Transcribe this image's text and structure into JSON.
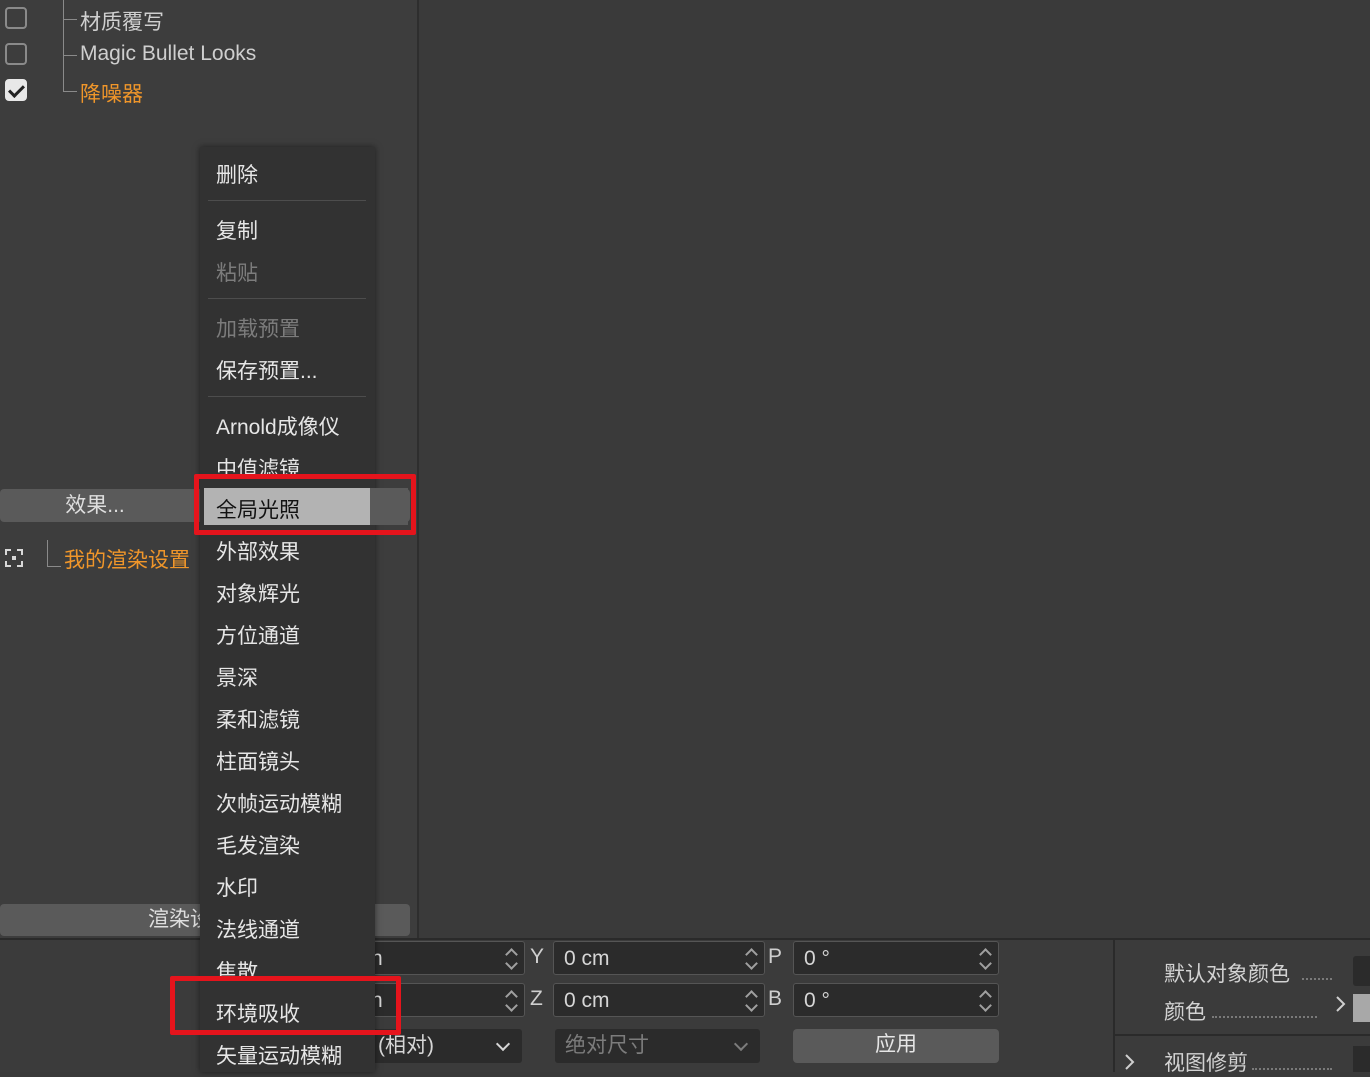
{
  "tree": {
    "items": [
      {
        "label": "材质覆写",
        "checked": false
      },
      {
        "label": "Magic Bullet Looks",
        "checked": false
      },
      {
        "label": "降噪器",
        "checked": true
      }
    ],
    "render_setting": "我的渲染设置"
  },
  "buttons": {
    "effects": "效果...",
    "render_settings_partial": "渲染设"
  },
  "context_menu": {
    "items": [
      {
        "label": "删除",
        "enabled": true
      },
      {
        "label": "复制",
        "enabled": true
      },
      {
        "label": "粘贴",
        "enabled": false
      },
      {
        "label": "加载预置",
        "enabled": false
      },
      {
        "label": "保存预置...",
        "enabled": true
      },
      {
        "label": "Arnold成像仪",
        "enabled": true
      },
      {
        "label": "中值滤镜",
        "enabled": true
      },
      {
        "label": "全局光照",
        "enabled": true,
        "highlighted": true
      },
      {
        "label": "外部效果",
        "enabled": true
      },
      {
        "label": "对象辉光",
        "enabled": true
      },
      {
        "label": "方位通道",
        "enabled": true
      },
      {
        "label": "景深",
        "enabled": true
      },
      {
        "label": "柔和滤镜",
        "enabled": true
      },
      {
        "label": "柱面镜头",
        "enabled": true
      },
      {
        "label": "次帧运动模糊",
        "enabled": true
      },
      {
        "label": "毛发渲染",
        "enabled": true
      },
      {
        "label": "水印",
        "enabled": true
      },
      {
        "label": "法线通道",
        "enabled": true
      },
      {
        "label": "焦散",
        "enabled": true
      },
      {
        "label": "环境吸收",
        "enabled": true
      },
      {
        "label": "矢量运动模糊",
        "enabled": true
      }
    ]
  },
  "coords": {
    "y_label": "Y",
    "y_value": "0 cm",
    "z_label": "Z",
    "z_value": "0 cm",
    "p_label": "P",
    "p_value": "0 °",
    "b_label": "B",
    "b_value": "0 °",
    "x_partial": "n",
    "z_partial": "n",
    "mode_select": "(相对)",
    "size_select": "绝对尺寸",
    "apply": "应用"
  },
  "attributes": {
    "default_object_color": "默认对象颜色",
    "color": "颜色",
    "view_clip": "视图修剪"
  },
  "colors": {
    "accent_orange": "#f0962a",
    "annotation_red": "#e5141c",
    "menu_highlight": "#b3b3b3"
  }
}
